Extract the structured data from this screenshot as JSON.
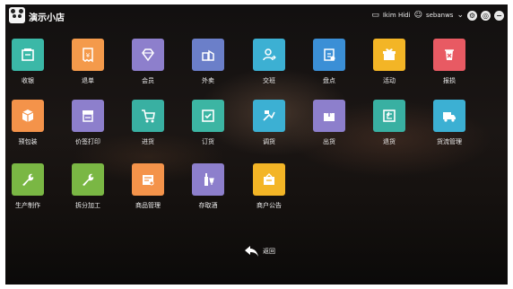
{
  "header": {
    "shop_name": "演示小店",
    "user_text": "Ikim Hidi",
    "user_name": "sebanws",
    "icons": [
      "monitor-icon",
      "user-icon",
      "chevron-down-icon",
      "settings-icon",
      "info-icon",
      "power-icon"
    ]
  },
  "tiles": [
    {
      "label": "收银",
      "color": "#3bb8a7",
      "icon": "cash-register-icon"
    },
    {
      "label": "退单",
      "color": "#f49a4b",
      "icon": "receipt-icon"
    },
    {
      "label": "会员",
      "color": "#8d7fcc",
      "icon": "diamond-icon"
    },
    {
      "label": "外卖",
      "color": "#6b7fc9",
      "icon": "delivery-icon"
    },
    {
      "label": "交班",
      "color": "#3cb0d3",
      "icon": "handover-icon"
    },
    {
      "label": "盘点",
      "color": "#3b8fd6",
      "icon": "stocktake-icon"
    },
    {
      "label": "活动",
      "color": "#f3b526",
      "icon": "gift-icon"
    },
    {
      "label": "报损",
      "color": "#e85a63",
      "icon": "damage-icon"
    },
    {
      "label": "预包装",
      "color": "#f4934a",
      "icon": "package-icon"
    },
    {
      "label": "价签打印",
      "color": "#8d7fcc",
      "icon": "printer-icon"
    },
    {
      "label": "进货",
      "color": "#39b0a2",
      "icon": "cart-icon"
    },
    {
      "label": "订货",
      "color": "#3cb5a3",
      "icon": "order-check-icon"
    },
    {
      "label": "调货",
      "color": "#3cb0d3",
      "icon": "transfer-icon"
    },
    {
      "label": "出货",
      "color": "#8d7fcc",
      "icon": "outbound-icon"
    },
    {
      "label": "退货",
      "color": "#39b0a2",
      "icon": "return-icon"
    },
    {
      "label": "货流管理",
      "color": "#3cb0d3",
      "icon": "truck-icon"
    },
    {
      "label": "生产制作",
      "color": "#7ab744",
      "icon": "wrench-icon"
    },
    {
      "label": "拆分加工",
      "color": "#7ab744",
      "icon": "wrench-icon"
    },
    {
      "label": "商品管理",
      "color": "#f4934a",
      "icon": "goods-icon"
    },
    {
      "label": "存取酒",
      "color": "#8d7fcc",
      "icon": "wine-icon"
    },
    {
      "label": "商户公告",
      "color": "#f3b526",
      "icon": "notice-icon"
    }
  ],
  "back": {
    "label": "返回",
    "icon": "back-arrow-icon"
  }
}
